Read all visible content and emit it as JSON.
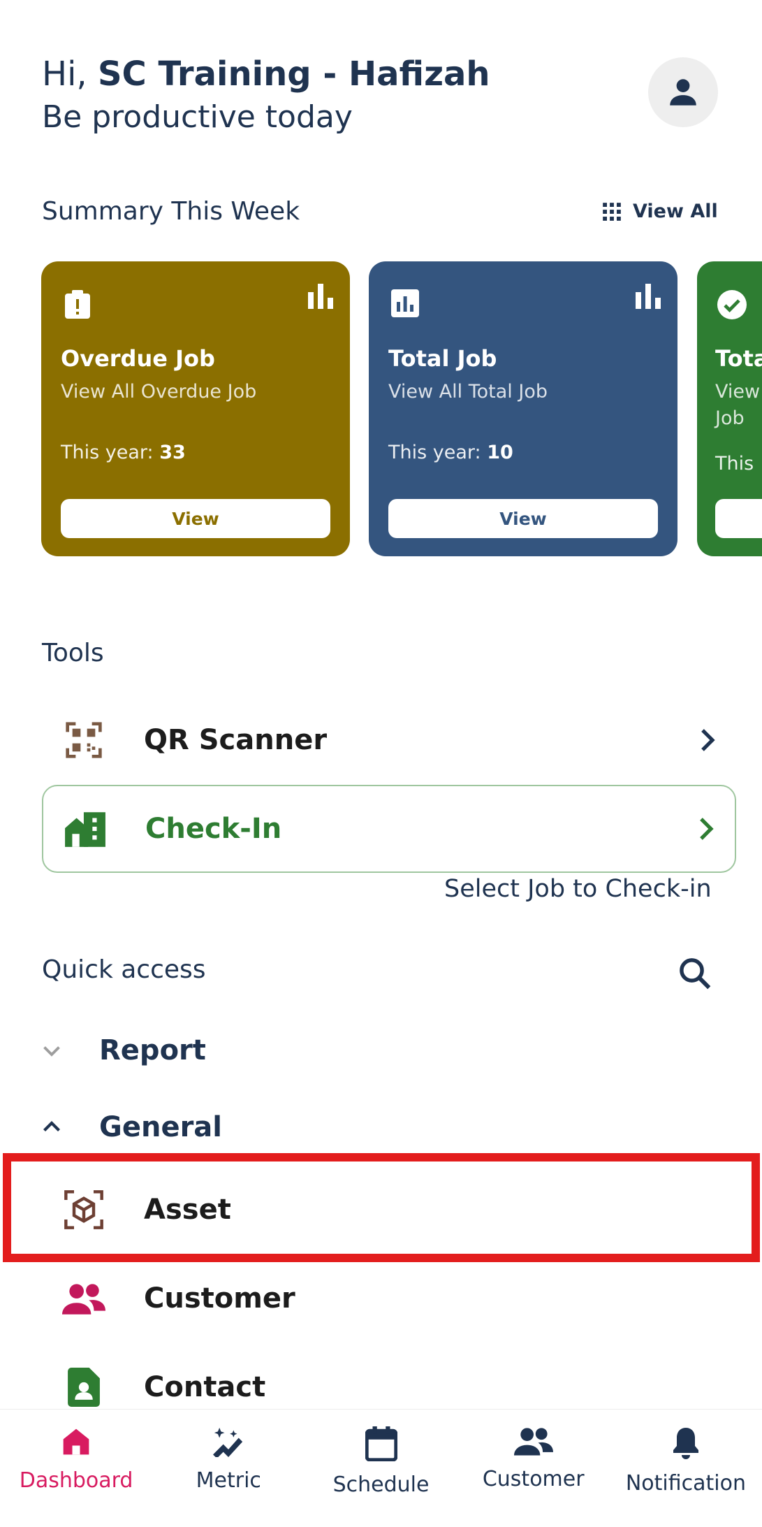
{
  "header": {
    "greeting_prefix": "Hi,",
    "user_name": "SC Training - Hafizah",
    "subtitle": "Be productive today"
  },
  "summary": {
    "title": "Summary This Week",
    "view_all_label": "View All",
    "cards": [
      {
        "title": "Overdue Job",
        "desc": "View All Overdue Job",
        "year_label": "This year:",
        "year_value": "33",
        "button": "View",
        "color": "#8b6f00"
      },
      {
        "title": "Total Job",
        "desc": "View All Total Job",
        "year_label": "This year:",
        "year_value": "10",
        "button": "View",
        "color": "#34557f"
      },
      {
        "title": "Tota",
        "desc": "View\nJob",
        "year_label": "This",
        "year_value": "",
        "button": "",
        "color": "#2e7d32"
      }
    ]
  },
  "tools": {
    "title": "Tools",
    "qr_label": "QR Scanner",
    "checkin_label": "Check-In",
    "checkin_hint": "Select Job to Check-in"
  },
  "quick_access": {
    "title": "Quick access",
    "groups": [
      {
        "label": "Report",
        "expanded": false
      },
      {
        "label": "General",
        "expanded": true
      }
    ],
    "items": [
      {
        "label": "Asset",
        "icon": "cube-scan-icon"
      },
      {
        "label": "Customer",
        "icon": "users-icon"
      },
      {
        "label": "Contact",
        "icon": "contact-card-icon"
      }
    ]
  },
  "nav": {
    "items": [
      {
        "label": "Dashboard",
        "icon": "home-icon",
        "active": true
      },
      {
        "label": "Metric",
        "icon": "sparkle-chart-icon"
      },
      {
        "label": "Schedule",
        "icon": "calendar-icon"
      },
      {
        "label": "Customer",
        "icon": "users-icon"
      },
      {
        "label": "Notification",
        "icon": "bell-icon"
      }
    ]
  },
  "colors": {
    "primary": "#1f3350",
    "overdue": "#8b6f00",
    "total": "#34557f",
    "completed": "#2e7d32",
    "checkin": "#2e7d32",
    "active_nav": "#d81b60",
    "highlight": "#e31d1d"
  }
}
